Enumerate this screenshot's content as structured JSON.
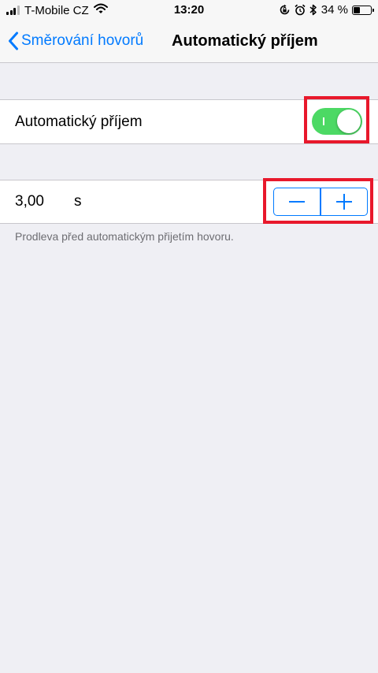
{
  "status_bar": {
    "carrier": "T-Mobile CZ",
    "time": "13:20",
    "battery_text": "34 %",
    "battery_level": 0.34,
    "signal_bars": 3,
    "icons": [
      "wifi-icon",
      "rotation-lock-icon",
      "alarm-icon",
      "bluetooth-icon",
      "battery-icon"
    ]
  },
  "nav": {
    "back_label": "Směrování hovorů",
    "title": "Automatický příjem"
  },
  "auto_answer": {
    "label": "Automatický příjem",
    "enabled": true
  },
  "delay": {
    "value": "3,00",
    "unit": "s",
    "decrement_symbol": "minus",
    "increment_symbol": "plus",
    "footer": "Prodleva před automatickým přijetím hovoru."
  },
  "colors": {
    "accent": "#007aff",
    "toggle_on": "#4cd964",
    "highlight": "#e8182b",
    "background": "#efeff4"
  }
}
